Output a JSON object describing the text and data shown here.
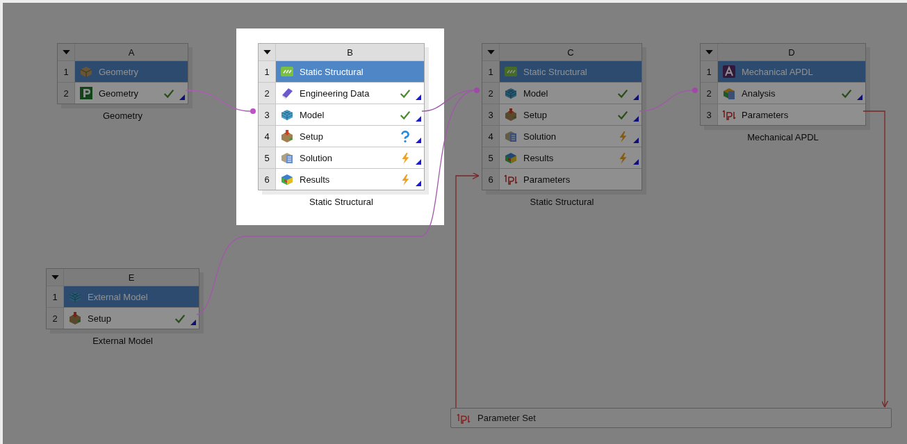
{
  "systems": [
    {
      "letter": "A",
      "caption": "Geometry",
      "highlighted": false,
      "rows": [
        {
          "number": "1",
          "kind": "geometry",
          "label": "Geometry",
          "selected": true,
          "up_to_date": false,
          "attention_required": false,
          "update_required": false
        },
        {
          "number": "2",
          "kind": "design-modeler",
          "label": "Geometry",
          "selected": false,
          "up_to_date": true,
          "attention_required": false,
          "update_required": false
        }
      ]
    },
    {
      "letter": "B",
      "caption": "Static Structural",
      "highlighted": true,
      "rows": [
        {
          "number": "1",
          "kind": "static-structural",
          "label": "Static Structural",
          "selected": true,
          "up_to_date": false,
          "attention_required": false,
          "update_required": false
        },
        {
          "number": "2",
          "kind": "engineering-data",
          "label": "Engineering Data",
          "selected": false,
          "up_to_date": true,
          "attention_required": false,
          "update_required": false
        },
        {
          "number": "3",
          "kind": "model",
          "label": "Model",
          "selected": false,
          "up_to_date": true,
          "attention_required": false,
          "update_required": false
        },
        {
          "number": "4",
          "kind": "setup",
          "label": "Setup",
          "selected": false,
          "up_to_date": false,
          "attention_required": true,
          "update_required": false
        },
        {
          "number": "5",
          "kind": "solution",
          "label": "Solution",
          "selected": false,
          "up_to_date": false,
          "attention_required": false,
          "update_required": true
        },
        {
          "number": "6",
          "kind": "results",
          "label": "Results",
          "selected": false,
          "up_to_date": false,
          "attention_required": false,
          "update_required": true
        }
      ]
    },
    {
      "letter": "C",
      "caption": "Static Structural",
      "highlighted": false,
      "rows": [
        {
          "number": "1",
          "kind": "static-structural",
          "label": "Static Structural",
          "selected": true,
          "up_to_date": false,
          "attention_required": false,
          "update_required": false
        },
        {
          "number": "2",
          "kind": "model",
          "label": "Model",
          "selected": false,
          "up_to_date": true,
          "attention_required": false,
          "update_required": false
        },
        {
          "number": "3",
          "kind": "setup",
          "label": "Setup",
          "selected": false,
          "up_to_date": true,
          "attention_required": false,
          "update_required": false
        },
        {
          "number": "4",
          "kind": "solution",
          "label": "Solution",
          "selected": false,
          "up_to_date": false,
          "attention_required": false,
          "update_required": true
        },
        {
          "number": "5",
          "kind": "results",
          "label": "Results",
          "selected": false,
          "up_to_date": false,
          "attention_required": false,
          "update_required": true
        },
        {
          "number": "6",
          "kind": "parameters",
          "label": "Parameters",
          "selected": false,
          "up_to_date": false,
          "attention_required": false,
          "update_required": false
        }
      ]
    },
    {
      "letter": "D",
      "caption": "Mechanical APDL",
      "highlighted": false,
      "rows": [
        {
          "number": "1",
          "kind": "apdl",
          "label": "Mechanical APDL",
          "selected": true,
          "up_to_date": false,
          "attention_required": false,
          "update_required": false
        },
        {
          "number": "2",
          "kind": "analysis",
          "label": "Analysis",
          "selected": false,
          "up_to_date": true,
          "attention_required": false,
          "update_required": false
        },
        {
          "number": "3",
          "kind": "parameters",
          "label": "Parameters",
          "selected": false,
          "up_to_date": false,
          "attention_required": false,
          "update_required": false
        }
      ]
    },
    {
      "letter": "E",
      "caption": "External Model",
      "highlighted": false,
      "rows": [
        {
          "number": "1",
          "kind": "model",
          "label": "External Model",
          "selected": true,
          "up_to_date": false,
          "attention_required": false,
          "update_required": false
        },
        {
          "number": "2",
          "kind": "setup",
          "label": "Setup",
          "selected": false,
          "up_to_date": true,
          "attention_required": false,
          "update_required": false
        }
      ]
    }
  ],
  "parameter_set": {
    "label": "Parameter Set"
  }
}
